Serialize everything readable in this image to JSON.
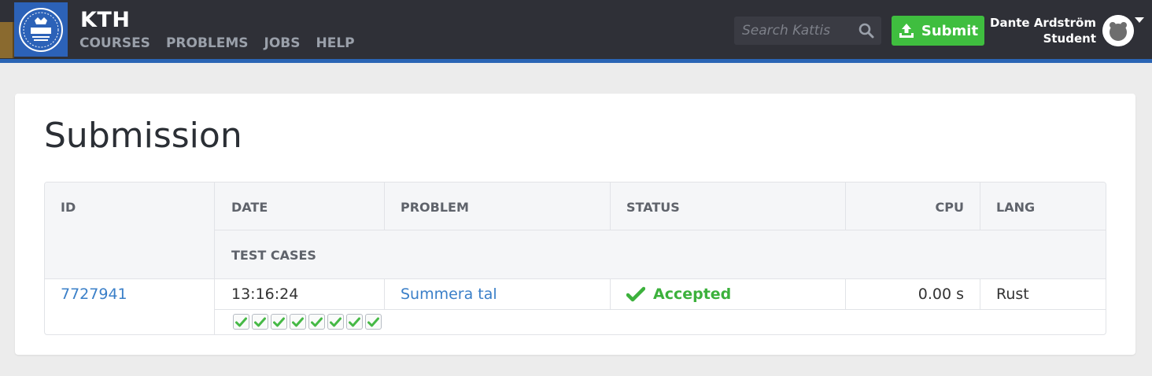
{
  "header": {
    "brand": "KTH",
    "logo_icon": "kth-logo-icon",
    "nav": [
      "COURSES",
      "PROBLEMS",
      "JOBS",
      "HELP"
    ],
    "search_placeholder": "Search Kattis",
    "submit_label": "Submit",
    "user": {
      "name": "Dante Ardström",
      "role": "Student"
    }
  },
  "page": {
    "title": "Submission"
  },
  "table": {
    "headers": {
      "id": "ID",
      "date": "DATE",
      "problem": "PROBLEM",
      "status": "STATUS",
      "cpu": "CPU",
      "lang": "LANG",
      "test_cases": "TEST CASES"
    },
    "row": {
      "id": "7727941",
      "date": "13:16:24",
      "problem": "Summera tal",
      "status": "Accepted",
      "cpu": "0.00 s",
      "lang": "Rust",
      "test_cases": [
        "passed",
        "passed",
        "passed",
        "passed",
        "passed",
        "passed",
        "passed",
        "passed"
      ]
    }
  },
  "colors": {
    "navbar": "#2f3037",
    "accent_blue": "#2a65b5",
    "submit_green": "#3fbe3f",
    "accepted_green": "#3cb13c",
    "link_blue": "#3a7fc8"
  }
}
